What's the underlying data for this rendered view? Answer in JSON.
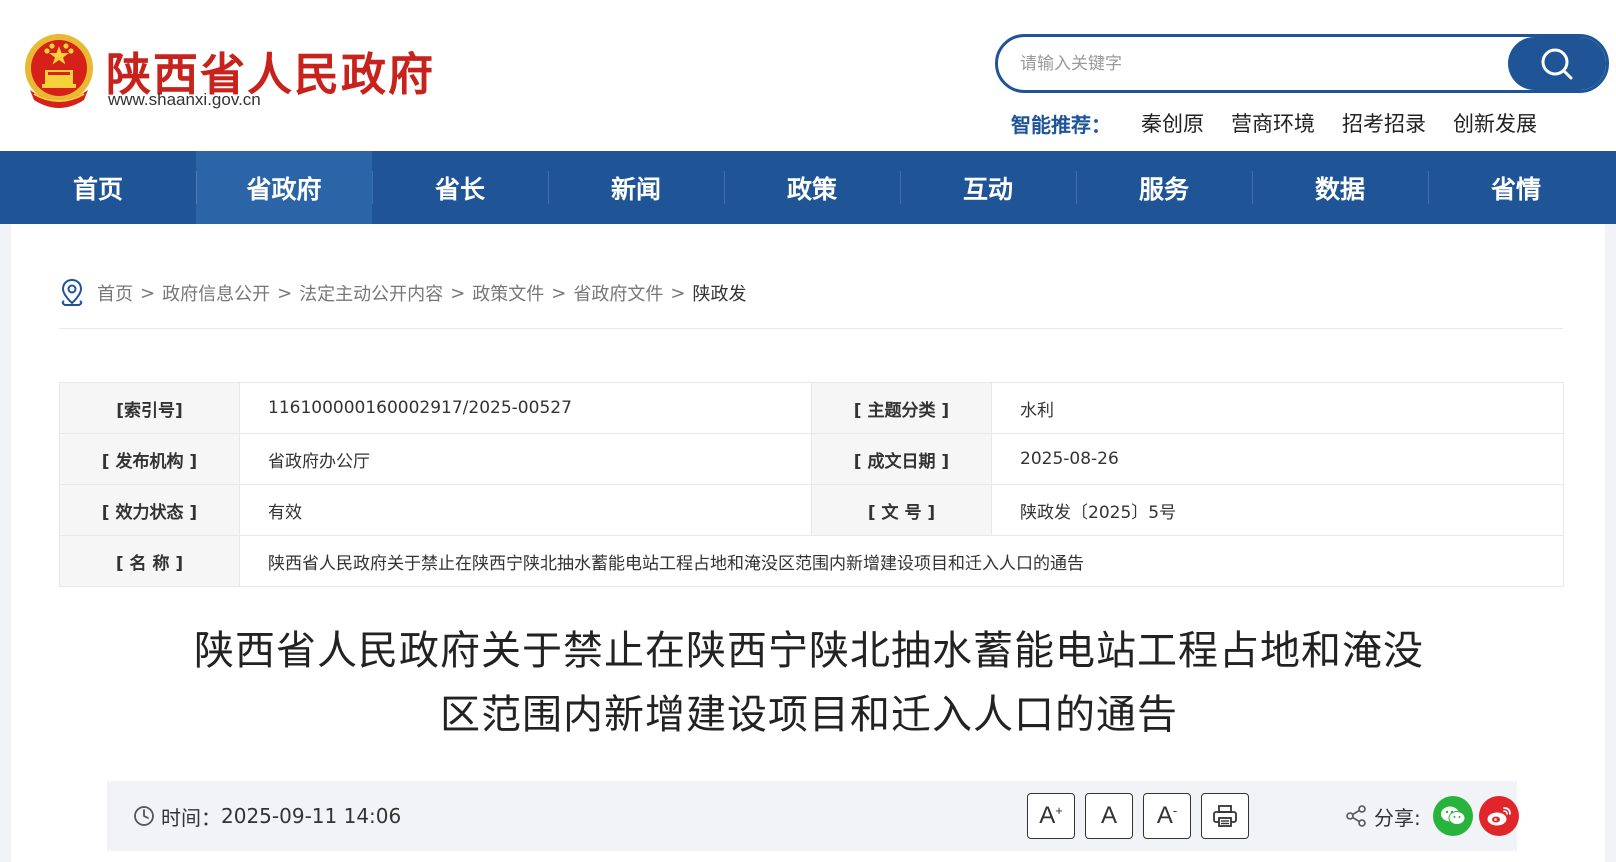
{
  "header": {
    "site_title": "陕西省人民政府",
    "site_url": "www.shaanxi.gov.cn",
    "search_placeholder": "请输入关键字",
    "recommend_label": "智能推荐：",
    "recommend_items": [
      "秦创原",
      "营商环境",
      "招考招录",
      "创新发展"
    ]
  },
  "nav": {
    "items": [
      "首页",
      "省政府",
      "省长",
      "新闻",
      "政策",
      "互动",
      "服务",
      "数据",
      "省情"
    ],
    "active": "省政府"
  },
  "breadcrumb": {
    "items": [
      "首页",
      "政府信息公开",
      "法定主动公开内容",
      "政策文件",
      "省政府文件"
    ],
    "current": "陕政发",
    "separator": ">"
  },
  "meta": {
    "index_label": "[索引号]",
    "index_value": "11610000016000291​7/2025-00527",
    "topic_label": "[ 主题分类 ]",
    "topic_value": "水利",
    "issuer_label": "[ 发布机构 ]",
    "issuer_value": "省政府办公厅",
    "date_label": "[ 成文日期 ]",
    "date_value": "2025-08-26",
    "status_label": "[ 效力状态 ]",
    "status_value": "有效",
    "docno_label": "[ 文 号 ]",
    "docno_value": "陕政发〔2025〕5号",
    "name_label": "[ 名 称 ]",
    "name_value": "陕西省人民政府关于禁止在陕西宁陕北抽水蓄能电站工程占地和淹没区范围内新增建设项目和迁入人口的通告"
  },
  "article": {
    "title_line1": "陕西省人民政府关于禁止在陕西宁陕北抽水蓄能电站工程占地和淹没",
    "title_line2": "区范围内新增建设项目和迁入人口的通告",
    "time_label": "时间：",
    "time_value": "2025-09-11 14:06",
    "share_label": "分享:"
  },
  "toolbar": {
    "font_larger": "A",
    "font_normal": "A",
    "font_smaller": "A",
    "plus_mark": "+",
    "minus_mark": "-"
  },
  "colors": {
    "brand_red": "#c7221b",
    "brand_blue": "#1f5597",
    "wechat_green": "#28b43c",
    "weibo_red": "#e0252b"
  }
}
